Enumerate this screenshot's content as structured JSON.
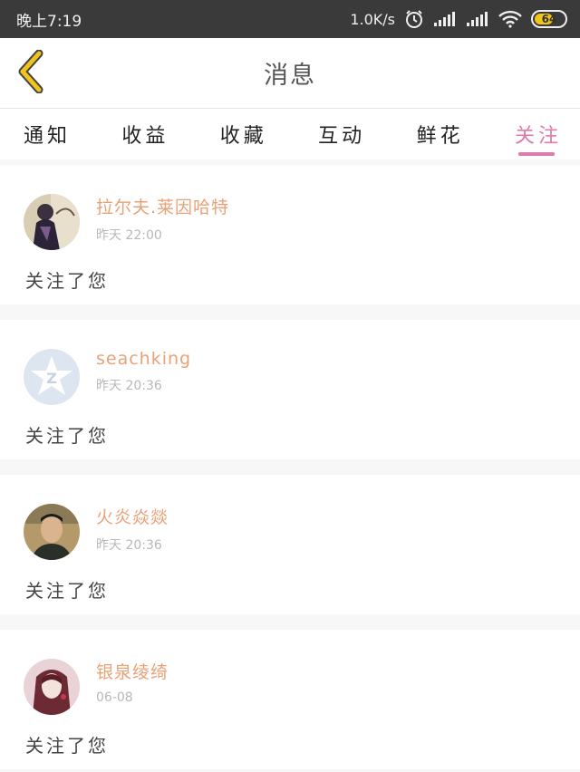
{
  "status_bar": {
    "time": "晚上7:19",
    "net_speed": "1.0K/s",
    "battery": "64",
    "battery_level": 0.64,
    "icons": [
      "alarm-icon",
      "signal-icon",
      "signal-icon",
      "wifi-icon",
      "battery-icon"
    ]
  },
  "header": {
    "back_icon": "chevron-left-icon",
    "title": "消息"
  },
  "tabs": [
    {
      "label": "通知",
      "active": false
    },
    {
      "label": "收益",
      "active": false
    },
    {
      "label": "收藏",
      "active": false
    },
    {
      "label": "互动",
      "active": false
    },
    {
      "label": "鲜花",
      "active": false
    },
    {
      "label": "关注",
      "active": true
    }
  ],
  "notifications": [
    {
      "username": "拉尔夫.莱因哈特",
      "time": "昨天 22:00",
      "message": "关注了您",
      "avatar": "avatar-anime-knight"
    },
    {
      "username": "seachking",
      "time": "昨天 20:36",
      "message": "关注了您",
      "avatar": "avatar-default-star"
    },
    {
      "username": "火炎焱燚",
      "time": "昨天 20:36",
      "message": "关注了您",
      "avatar": "avatar-photo-man"
    },
    {
      "username": "银泉绫绮",
      "time": "06-08",
      "message": "关注了您",
      "avatar": "avatar-anime-girl"
    }
  ],
  "colors": {
    "accent": "#e07aa8",
    "username": "#e8a277",
    "status_bar": "#3a3a3a",
    "back_arrow": "#f0c419"
  }
}
